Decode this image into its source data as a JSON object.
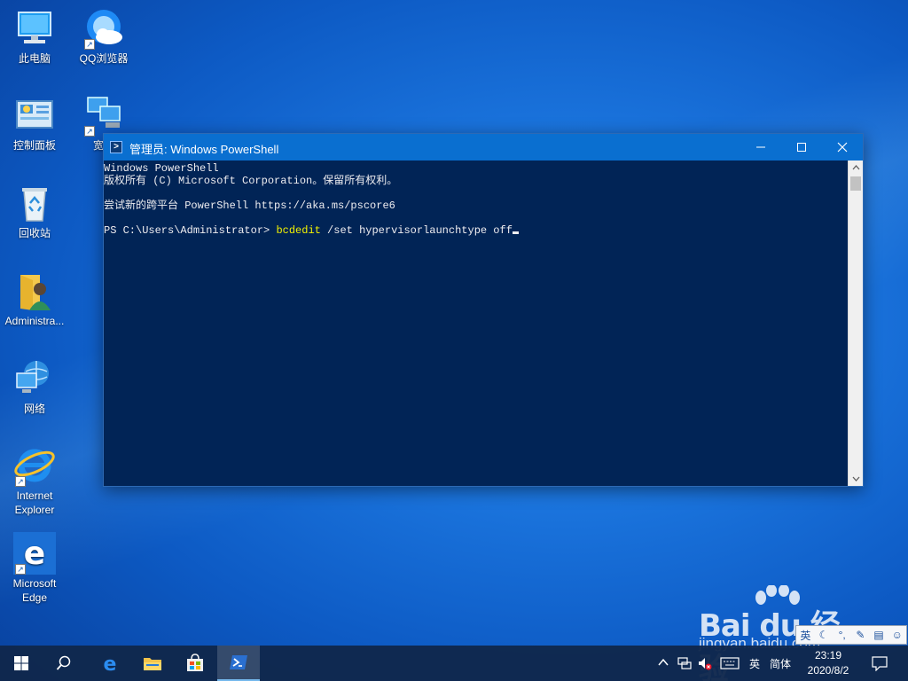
{
  "desktop": {
    "icons": [
      {
        "label": "此电脑"
      },
      {
        "label": "QQ浏览器"
      },
      {
        "label": "控制面板"
      },
      {
        "label": "宽带"
      },
      {
        "label": "回收站"
      },
      {
        "label": "Administra..."
      },
      {
        "label": "网络"
      },
      {
        "label": "Internet Explorer"
      },
      {
        "label": "Microsoft Edge"
      }
    ]
  },
  "window": {
    "title": "管理员: Windows PowerShell",
    "console": {
      "line1": "Windows PowerShell",
      "line2": "版权所有 (C) Microsoft Corporation。保留所有权利。",
      "line3": "尝试新的跨平台 PowerShell https://aka.ms/pscore6",
      "prompt": "PS C:\\Users\\Administrator> ",
      "command": "bcdedit",
      "args": " /set hypervisorlaunchtype off"
    }
  },
  "taskbar": {
    "ime_lang": "英",
    "ime_mode": "简体",
    "time": "23:19",
    "date": "2020/8/2"
  },
  "ime_toolbar": {
    "mode_label": "英"
  },
  "watermark": {
    "logo": "Bai du 经验",
    "url": "jingyan.baidu.com"
  },
  "colors": {
    "console_bg": "#012456",
    "titlebar": "#0a6fd0",
    "command": "#f2f200",
    "taskbar": "#10284c"
  }
}
